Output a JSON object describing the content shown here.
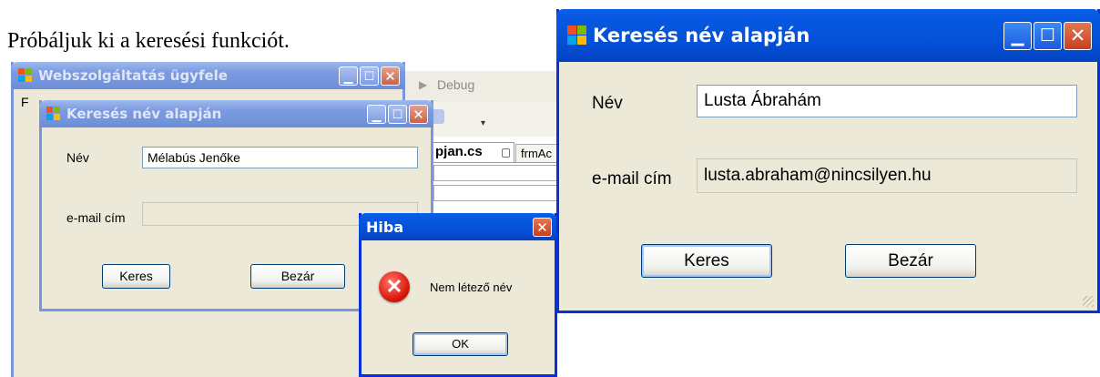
{
  "caption": "Próbáljuk ki a keresési funkciót.",
  "ide": {
    "debug_label": "Debug",
    "tab_active": "pjan.cs",
    "tab_other": "frmAc"
  },
  "main_window": {
    "title": "Webszolgáltatás ügyfele",
    "menu_fragment": "F"
  },
  "search_dialog_small": {
    "title": "Keresés név alapján",
    "name_label": "Név",
    "name_value": "Mélabús Jenőke",
    "email_label": "e-mail cím",
    "email_value": "",
    "search_button": "Keres",
    "close_button": "Bezár"
  },
  "error_box": {
    "title": "Hiba",
    "message": "Nem létező név",
    "ok_button": "OK",
    "icon": "error-icon"
  },
  "search_dialog_large": {
    "title": "Keresés név alapján",
    "name_label": "Név",
    "name_value": "Lusta Ábrahám",
    "email_label": "e-mail cím",
    "email_value": "lusta.abraham@nincsilyen.hu",
    "search_button": "Keres",
    "close_button": "Bezár"
  },
  "colors": {
    "titlebar_active": "#0551d8",
    "titlebar_inactive": "#7495dc",
    "window_face": "#ece9d8",
    "close_button": "#c3401f"
  }
}
